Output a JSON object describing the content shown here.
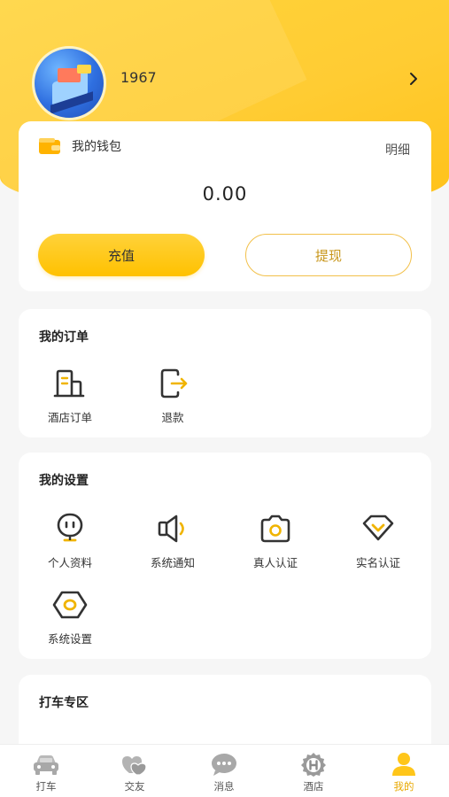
{
  "profile": {
    "username": "1967"
  },
  "wallet": {
    "title": "我的钱包",
    "detail_label": "明细",
    "balance": "0.00",
    "recharge_label": "充值",
    "withdraw_label": "提现"
  },
  "orders": {
    "title": "我的订单",
    "items": [
      {
        "label": "酒店订单",
        "icon": "hotel-order-icon"
      },
      {
        "label": "退款",
        "icon": "refund-icon"
      }
    ]
  },
  "settings": {
    "title": "我的设置",
    "items": [
      {
        "label": "个人资料",
        "icon": "profile-icon"
      },
      {
        "label": "系统通知",
        "icon": "notification-icon"
      },
      {
        "label": "真人认证",
        "icon": "camera-icon"
      },
      {
        "label": "实名认证",
        "icon": "id-verify-icon"
      },
      {
        "label": "系统设置",
        "icon": "settings-icon"
      }
    ]
  },
  "taxi": {
    "title": "打车专区"
  },
  "tabbar": {
    "tabs": [
      {
        "label": "打车",
        "icon": "car-icon"
      },
      {
        "label": "交友",
        "icon": "friends-icon"
      },
      {
        "label": "消息",
        "icon": "message-icon"
      },
      {
        "label": "酒店",
        "icon": "hotel-icon"
      },
      {
        "label": "我的",
        "icon": "user-icon"
      }
    ],
    "active_index": 4
  },
  "colors": {
    "accent": "#ffc61a",
    "accent_dark": "#e8a800",
    "background": "#f6f6f6"
  }
}
